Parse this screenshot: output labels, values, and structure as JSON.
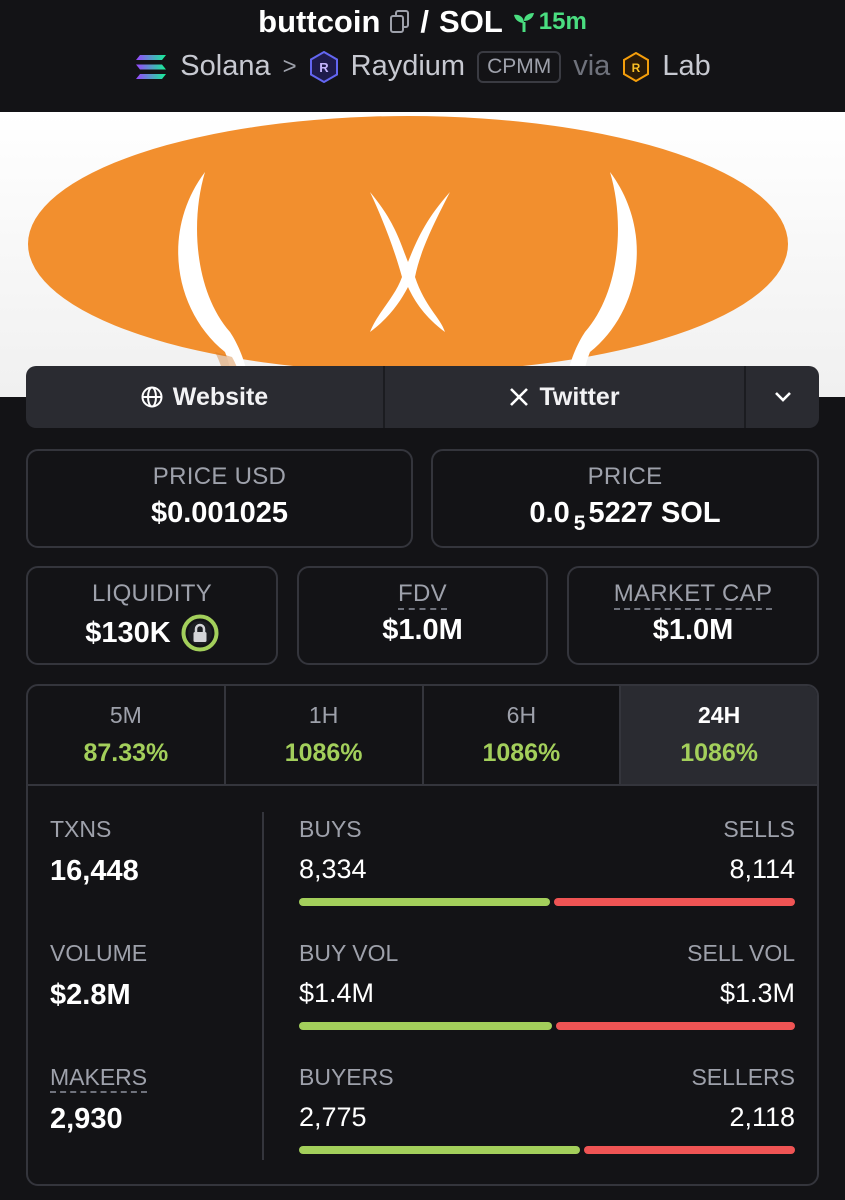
{
  "header": {
    "token": "buttcoin",
    "separator": "/",
    "quote": "SOL",
    "age": "15m",
    "chain": "Solana",
    "dex": "Raydium",
    "pool_type": "CPMM",
    "via": "via",
    "launchpad": "Lab"
  },
  "links": {
    "website": "Website",
    "twitter": "Twitter"
  },
  "price_usd": {
    "label": "PRICE USD",
    "value": "$0.001025"
  },
  "price_native": {
    "label": "PRICE",
    "prefix": "0.0",
    "zeros_sub": "5",
    "digits": "5227",
    "unit": "SOL"
  },
  "liquidity": {
    "label": "LIQUIDITY",
    "value": "$130K"
  },
  "fdv": {
    "label": "FDV",
    "value": "$1.0M"
  },
  "market_cap": {
    "label": "MARKET CAP",
    "value": "$1.0M"
  },
  "timeframes": [
    {
      "label": "5M",
      "change": "87.33%"
    },
    {
      "label": "1H",
      "change": "1086%"
    },
    {
      "label": "6H",
      "change": "1086%"
    },
    {
      "label": "24H",
      "change": "1086%",
      "active": true
    }
  ],
  "stats": {
    "txns": {
      "label": "TXNS",
      "value": "16,448"
    },
    "volume": {
      "label": "VOLUME",
      "value": "$2.8M"
    },
    "makers": {
      "label": "MAKERS",
      "value": "2,930"
    },
    "buys": {
      "label": "BUYS",
      "value": "8,334",
      "ratio": 0.507
    },
    "sells": {
      "label": "SELLS",
      "value": "8,114"
    },
    "buy_vol": {
      "label": "BUY VOL",
      "value": "$1.4M",
      "ratio": 0.51
    },
    "sell_vol": {
      "label": "SELL VOL",
      "value": "$1.3M"
    },
    "buyers": {
      "label": "BUYERS",
      "value": "2,775",
      "ratio": 0.567
    },
    "sellers": {
      "label": "SELLERS",
      "value": "2,118"
    }
  },
  "colors": {
    "positive": "#a3cf5b",
    "negative": "#ef5454",
    "age": "#4ade80",
    "banner_orange": "#f28f2e"
  }
}
